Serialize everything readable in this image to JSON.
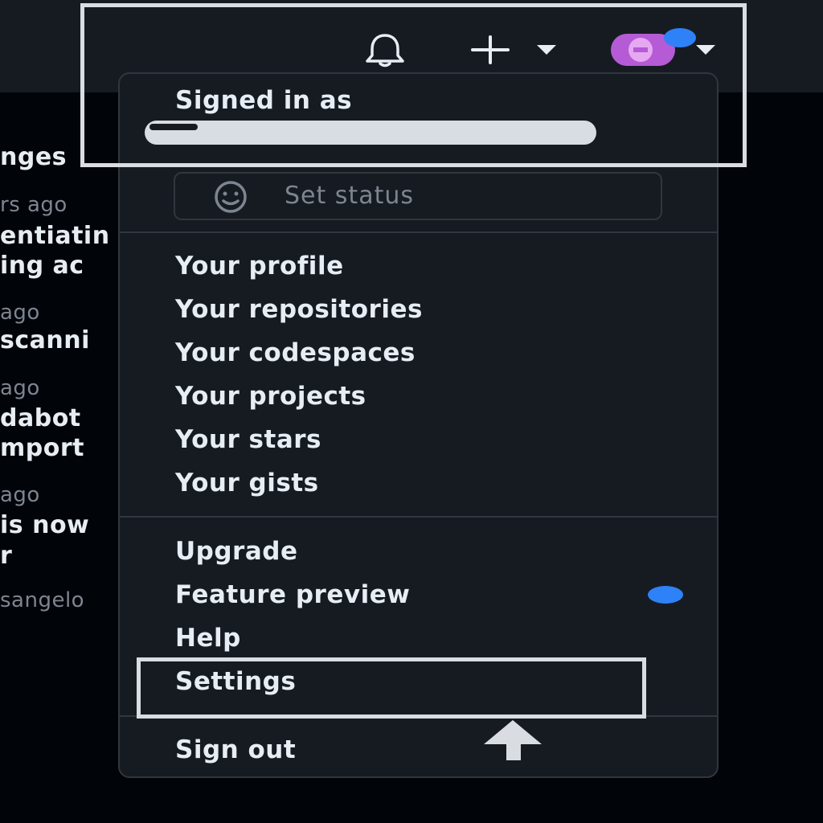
{
  "header": {
    "icons": [
      "bell-icon",
      "plus-icon",
      "chevron-down-icon",
      "avatar",
      "chevron-down-icon"
    ]
  },
  "feed": {
    "lines": [
      {
        "text": "nges",
        "kind": "title"
      },
      {
        "text": "rs ago",
        "kind": "meta"
      },
      {
        "text": "entiatin",
        "kind": "title"
      },
      {
        "text": "ing ac",
        "kind": "title"
      },
      {
        "text": "ago",
        "kind": "meta"
      },
      {
        "text": "scanni",
        "kind": "title"
      },
      {
        "text": "ago",
        "kind": "meta"
      },
      {
        "text": "dabot",
        "kind": "title"
      },
      {
        "text": "mport",
        "kind": "title"
      },
      {
        "text": "ago",
        "kind": "meta"
      },
      {
        "text": "is now",
        "kind": "title"
      },
      {
        "text": "r",
        "kind": "title"
      },
      {
        "text": "sangelo",
        "kind": "meta"
      }
    ]
  },
  "menu": {
    "signed_in_label": "Signed in as",
    "status_placeholder": "Set status",
    "section1": [
      "Your profile",
      "Your repositories",
      "Your codespaces",
      "Your projects",
      "Your stars",
      "Your gists"
    ],
    "section2": [
      "Upgrade",
      "Feature preview",
      "Help",
      "Settings"
    ],
    "sign_out": "Sign out"
  },
  "colors": {
    "background": "#010409",
    "header": "#161b22",
    "menu": "#161b22",
    "border": "#30363d",
    "accent_blue": "#2f81f7",
    "avatar": "#b55bd6",
    "annotation": "#d9dde2"
  }
}
